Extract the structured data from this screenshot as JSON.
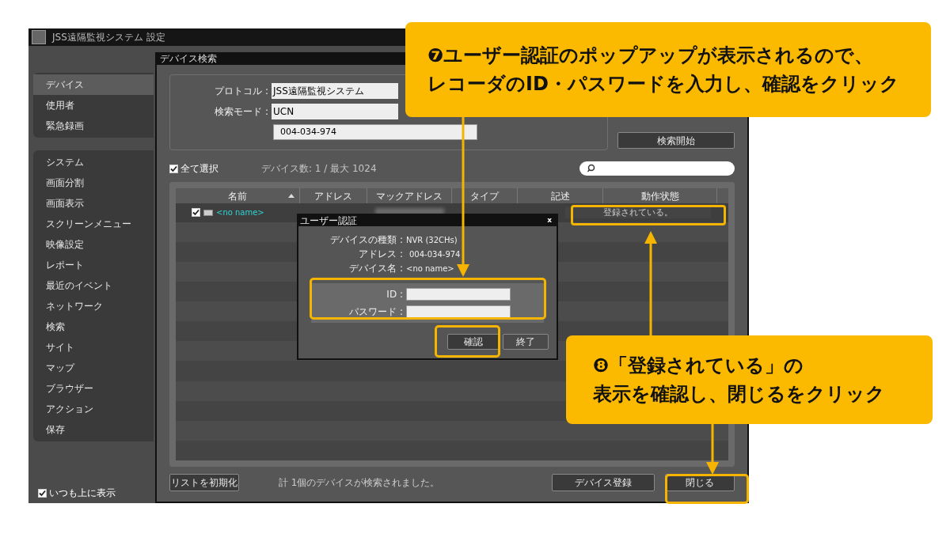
{
  "window": {
    "title": "JSS遠隔監視システム 設定"
  },
  "sidebar": {
    "groups": [
      [
        {
          "label": "デバイス",
          "selected": true
        },
        {
          "label": "使用者",
          "selected": false
        },
        {
          "label": "緊急録画",
          "selected": false
        }
      ],
      [
        {
          "label": "システム",
          "selected": false
        },
        {
          "label": "画面分割",
          "selected": false
        },
        {
          "label": "画面表示",
          "selected": false
        },
        {
          "label": "スクリーンメニュー",
          "selected": false
        },
        {
          "label": "映像設定",
          "selected": false
        },
        {
          "label": "レポート",
          "selected": false
        },
        {
          "label": "最近のイベント",
          "selected": false
        },
        {
          "label": "ネットワーク",
          "selected": false
        },
        {
          "label": "検索",
          "selected": false
        },
        {
          "label": "サイト",
          "selected": false
        },
        {
          "label": "マップ",
          "selected": false
        },
        {
          "label": "ブラウザー",
          "selected": false
        },
        {
          "label": "アクション",
          "selected": false
        },
        {
          "label": "保存",
          "selected": false
        }
      ]
    ],
    "always_on_top": {
      "label": "いつも上に表示",
      "checked": true
    }
  },
  "dialog": {
    "title": "デバイス検索",
    "protocol": {
      "label": "プロトコル :",
      "value": "JSS遠隔監視システム"
    },
    "search_mode": {
      "label": "検索モード :",
      "value": "UCN"
    },
    "address": {
      "value": "004-034-974"
    },
    "start_button": "検索開始",
    "select_all": {
      "label": "全て選択",
      "checked": true
    },
    "device_count": "デバイス数: 1 / 最大 1024",
    "table": {
      "columns": [
        {
          "label": "名前",
          "sorted": true
        },
        {
          "label": "アドレス",
          "sorted": false
        },
        {
          "label": "マックアドレス",
          "sorted": false
        },
        {
          "label": "タイプ",
          "sorted": false
        },
        {
          "label": "記述",
          "sorted": false
        },
        {
          "label": "動作状態",
          "sorted": false
        }
      ],
      "rows": [
        {
          "checked": true,
          "name": "<no name>",
          "status": "登録されている。"
        }
      ]
    },
    "reset_button": "リストを初期化",
    "status": "計 1個のデバイスが検索されました。",
    "register_button": "デバイス登録",
    "close_button": "閉じる"
  },
  "auth_popup": {
    "title": "ユーザー認証",
    "close": "x",
    "info": [
      {
        "label": "デバイスの種類 :",
        "value": "NVR (32CHs)"
      },
      {
        "label": "アドレス :",
        "value": "004-034-974"
      },
      {
        "label": "デバイス名 :",
        "value": "<no name>"
      }
    ],
    "id_label": "ID :",
    "password_label": "パスワード :",
    "confirm_button": "確認",
    "exit_button": "終了"
  },
  "callouts": [
    {
      "lines": [
        "❼ユーザー認証のポップアップが表示されるので、",
        "レコーダのID・パスワードを入力し、確認をクリック"
      ]
    },
    {
      "lines": [
        "❽「登録されている」の",
        "表示を確認し、閉じるをクリック"
      ]
    }
  ]
}
